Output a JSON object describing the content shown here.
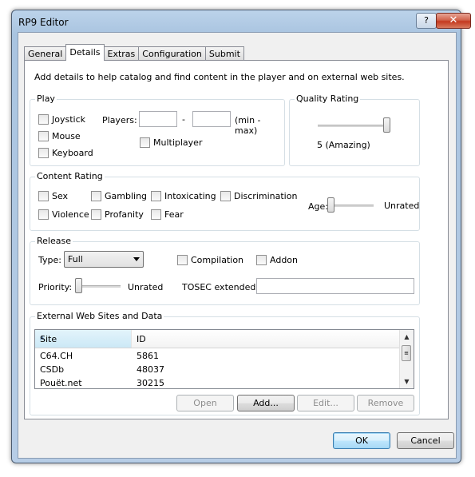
{
  "window": {
    "title": "RP9 Editor",
    "help_label": "?",
    "close_label": "✕"
  },
  "tabs": [
    "General",
    "Details",
    "Extras",
    "Configuration",
    "Submit"
  ],
  "intro_text": "Add details to help catalog and find content in the player and on external web sites.",
  "play": {
    "title": "Play",
    "joystick": "Joystick",
    "mouse": "Mouse",
    "keyboard": "Keyboard",
    "players_label": "Players:",
    "dash": "-",
    "range_hint": "(min - max)",
    "players_min": "",
    "players_max": "",
    "multiplayer": "Multiplayer"
  },
  "quality": {
    "title": "Quality Rating",
    "value_text": "5 (Amazing)",
    "level": 1.0
  },
  "content_rating": {
    "title": "Content Rating",
    "sex": "Sex",
    "gambling": "Gambling",
    "intoxicating": "Intoxicating",
    "discrimination": "Discrimination",
    "violence": "Violence",
    "profanity": "Profanity",
    "fear": "Fear",
    "age_label": "Age:",
    "age_value": "Unrated",
    "age_level": 0.0
  },
  "release": {
    "title": "Release",
    "type_label": "Type:",
    "type_value": "Full",
    "compilation": "Compilation",
    "addon": "Addon",
    "priority_label": "Priority:",
    "priority_value": "Unrated",
    "priority_level": 0.0,
    "tosec_label": "TOSEC extended:",
    "tosec_value": ""
  },
  "external": {
    "title": "External Web Sites and Data",
    "col_site": "Site",
    "col_id": "ID",
    "rows": [
      {
        "site": "C64.CH",
        "id": "5861"
      },
      {
        "site": "CSDb",
        "id": "48037"
      },
      {
        "site": "Pouët.net",
        "id": "30215"
      }
    ],
    "open": "Open",
    "add": "Add...",
    "edit": "Edit...",
    "remove": "Remove"
  },
  "footer": {
    "ok": "OK",
    "cancel": "Cancel"
  }
}
